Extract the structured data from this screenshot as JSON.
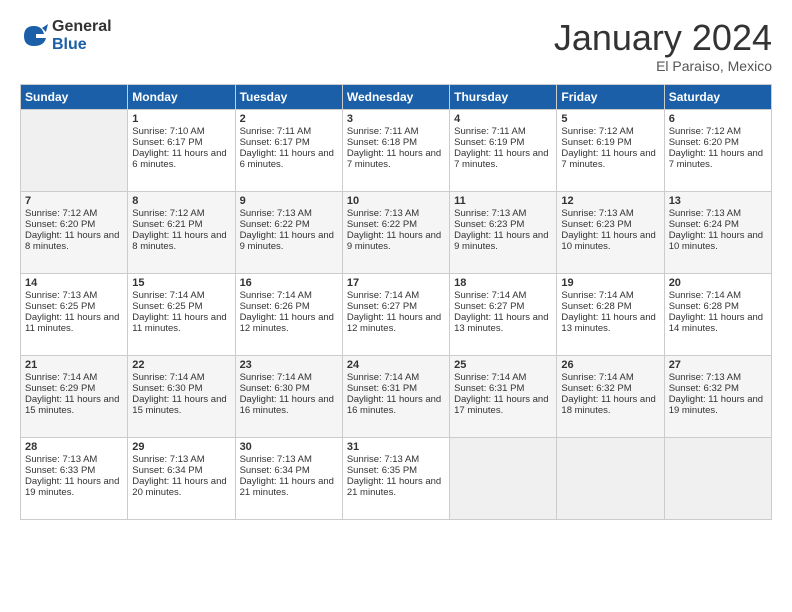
{
  "logo": {
    "general": "General",
    "blue": "Blue"
  },
  "title": "January 2024",
  "subtitle": "El Paraiso, Mexico",
  "days_of_week": [
    "Sunday",
    "Monday",
    "Tuesday",
    "Wednesday",
    "Thursday",
    "Friday",
    "Saturday"
  ],
  "weeks": [
    [
      {
        "day": "",
        "empty": true
      },
      {
        "day": "1",
        "sunrise": "7:10 AM",
        "sunset": "6:17 PM",
        "daylight": "11 hours and 6 minutes."
      },
      {
        "day": "2",
        "sunrise": "7:11 AM",
        "sunset": "6:17 PM",
        "daylight": "11 hours and 6 minutes."
      },
      {
        "day": "3",
        "sunrise": "7:11 AM",
        "sunset": "6:18 PM",
        "daylight": "11 hours and 7 minutes."
      },
      {
        "day": "4",
        "sunrise": "7:11 AM",
        "sunset": "6:19 PM",
        "daylight": "11 hours and 7 minutes."
      },
      {
        "day": "5",
        "sunrise": "7:12 AM",
        "sunset": "6:19 PM",
        "daylight": "11 hours and 7 minutes."
      },
      {
        "day": "6",
        "sunrise": "7:12 AM",
        "sunset": "6:20 PM",
        "daylight": "11 hours and 7 minutes."
      }
    ],
    [
      {
        "day": "7",
        "sunrise": "7:12 AM",
        "sunset": "6:20 PM",
        "daylight": "11 hours and 8 minutes."
      },
      {
        "day": "8",
        "sunrise": "7:12 AM",
        "sunset": "6:21 PM",
        "daylight": "11 hours and 8 minutes."
      },
      {
        "day": "9",
        "sunrise": "7:13 AM",
        "sunset": "6:22 PM",
        "daylight": "11 hours and 9 minutes."
      },
      {
        "day": "10",
        "sunrise": "7:13 AM",
        "sunset": "6:22 PM",
        "daylight": "11 hours and 9 minutes."
      },
      {
        "day": "11",
        "sunrise": "7:13 AM",
        "sunset": "6:23 PM",
        "daylight": "11 hours and 9 minutes."
      },
      {
        "day": "12",
        "sunrise": "7:13 AM",
        "sunset": "6:23 PM",
        "daylight": "11 hours and 10 minutes."
      },
      {
        "day": "13",
        "sunrise": "7:13 AM",
        "sunset": "6:24 PM",
        "daylight": "11 hours and 10 minutes."
      }
    ],
    [
      {
        "day": "14",
        "sunrise": "7:13 AM",
        "sunset": "6:25 PM",
        "daylight": "11 hours and 11 minutes."
      },
      {
        "day": "15",
        "sunrise": "7:14 AM",
        "sunset": "6:25 PM",
        "daylight": "11 hours and 11 minutes."
      },
      {
        "day": "16",
        "sunrise": "7:14 AM",
        "sunset": "6:26 PM",
        "daylight": "11 hours and 12 minutes."
      },
      {
        "day": "17",
        "sunrise": "7:14 AM",
        "sunset": "6:27 PM",
        "daylight": "11 hours and 12 minutes."
      },
      {
        "day": "18",
        "sunrise": "7:14 AM",
        "sunset": "6:27 PM",
        "daylight": "11 hours and 13 minutes."
      },
      {
        "day": "19",
        "sunrise": "7:14 AM",
        "sunset": "6:28 PM",
        "daylight": "11 hours and 13 minutes."
      },
      {
        "day": "20",
        "sunrise": "7:14 AM",
        "sunset": "6:28 PM",
        "daylight": "11 hours and 14 minutes."
      }
    ],
    [
      {
        "day": "21",
        "sunrise": "7:14 AM",
        "sunset": "6:29 PM",
        "daylight": "11 hours and 15 minutes."
      },
      {
        "day": "22",
        "sunrise": "7:14 AM",
        "sunset": "6:30 PM",
        "daylight": "11 hours and 15 minutes."
      },
      {
        "day": "23",
        "sunrise": "7:14 AM",
        "sunset": "6:30 PM",
        "daylight": "11 hours and 16 minutes."
      },
      {
        "day": "24",
        "sunrise": "7:14 AM",
        "sunset": "6:31 PM",
        "daylight": "11 hours and 16 minutes."
      },
      {
        "day": "25",
        "sunrise": "7:14 AM",
        "sunset": "6:31 PM",
        "daylight": "11 hours and 17 minutes."
      },
      {
        "day": "26",
        "sunrise": "7:14 AM",
        "sunset": "6:32 PM",
        "daylight": "11 hours and 18 minutes."
      },
      {
        "day": "27",
        "sunrise": "7:13 AM",
        "sunset": "6:32 PM",
        "daylight": "11 hours and 19 minutes."
      }
    ],
    [
      {
        "day": "28",
        "sunrise": "7:13 AM",
        "sunset": "6:33 PM",
        "daylight": "11 hours and 19 minutes."
      },
      {
        "day": "29",
        "sunrise": "7:13 AM",
        "sunset": "6:34 PM",
        "daylight": "11 hours and 20 minutes."
      },
      {
        "day": "30",
        "sunrise": "7:13 AM",
        "sunset": "6:34 PM",
        "daylight": "11 hours and 21 minutes."
      },
      {
        "day": "31",
        "sunrise": "7:13 AM",
        "sunset": "6:35 PM",
        "daylight": "11 hours and 21 minutes."
      },
      {
        "day": "",
        "empty": true
      },
      {
        "day": "",
        "empty": true
      },
      {
        "day": "",
        "empty": true
      }
    ]
  ]
}
